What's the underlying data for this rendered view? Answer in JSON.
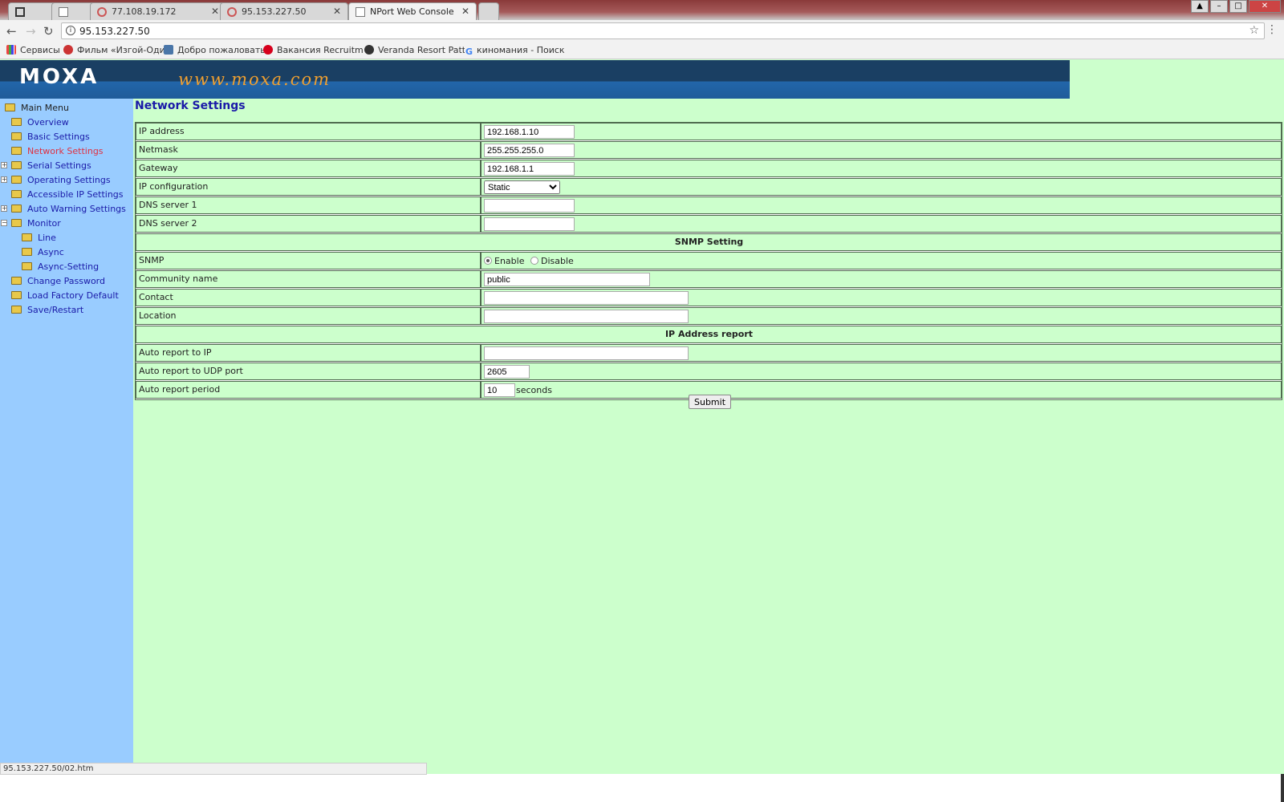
{
  "browser": {
    "tabs": [
      {
        "label": ""
      },
      {
        "label": ""
      },
      {
        "label": ""
      },
      {
        "label": "77.108.19.172"
      },
      {
        "label": "95.153.227.50"
      },
      {
        "label": "NPort Web Console"
      }
    ],
    "url": "95.153.227.50",
    "bookmarks": [
      {
        "label": "Сервисы"
      },
      {
        "label": "Фильм «Изгой-Один"
      },
      {
        "label": "Добро пожаловать"
      },
      {
        "label": "Вакансия Recruitmer"
      },
      {
        "label": "Veranda Resort Patta"
      },
      {
        "label": "киномания - Поиск"
      }
    ],
    "status_url": "95.153.227.50/02.htm"
  },
  "banner": {
    "logo": "MOXA",
    "site": "www.moxa.com"
  },
  "sidebar": {
    "root": "Main Menu",
    "items": [
      {
        "label": "Overview"
      },
      {
        "label": "Basic Settings"
      },
      {
        "label": "Network Settings",
        "active": true
      },
      {
        "label": "Serial Settings",
        "expandable": true
      },
      {
        "label": "Operating Settings",
        "expandable": true
      },
      {
        "label": "Accessible IP Settings"
      },
      {
        "label": "Auto Warning Settings",
        "expandable": true
      },
      {
        "label": "Monitor",
        "expanded": true
      },
      {
        "label": "Line"
      },
      {
        "label": "Async"
      },
      {
        "label": "Async-Setting"
      },
      {
        "label": "Change Password"
      },
      {
        "label": "Load Factory Default"
      },
      {
        "label": "Save/Restart"
      }
    ]
  },
  "main": {
    "title": "Network Settings",
    "fields": {
      "ip_address": {
        "label": "IP address",
        "value": "192.168.1.10"
      },
      "netmask": {
        "label": "Netmask",
        "value": "255.255.255.0"
      },
      "gateway": {
        "label": "Gateway",
        "value": "192.168.1.1"
      },
      "ip_config": {
        "label": "IP configuration",
        "value": "Static"
      },
      "dns1": {
        "label": "DNS server 1",
        "value": ""
      },
      "dns2": {
        "label": "DNS server 2",
        "value": ""
      },
      "snmp_section": "SNMP Setting",
      "snmp": {
        "label": "SNMP",
        "enable": "Enable",
        "disable": "Disable",
        "selected": "Enable"
      },
      "community": {
        "label": "Community name",
        "value": "public"
      },
      "contact": {
        "label": "Contact",
        "value": ""
      },
      "location": {
        "label": "Location",
        "value": ""
      },
      "report_section": "IP Address report",
      "report_ip": {
        "label": "Auto report to IP",
        "value": ""
      },
      "report_port": {
        "label": "Auto report to UDP port",
        "value": "2605"
      },
      "report_period": {
        "label": "Auto report period",
        "value": "10",
        "unit": "seconds"
      }
    },
    "submit": "Submit"
  }
}
